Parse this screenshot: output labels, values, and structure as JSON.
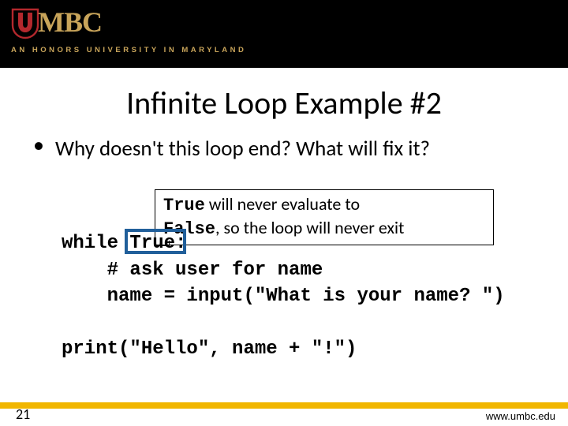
{
  "header": {
    "logo_text": "MBC",
    "honors_line": "AN HONORS UNIVERSITY IN MARYLAND"
  },
  "title": "Infinite Loop Example #2",
  "bullet": "Why doesn't this loop end?  What will fix it?",
  "callout": {
    "pre1": "True",
    "post1": "  will never evaluate to ",
    "pre2": "False",
    "post2": ", so the loop will never exit"
  },
  "code": {
    "block1": "while True:\n    # ask user for name\n    name = input(\"What is your name? \")",
    "block2": "print(\"Hello\", name + \"!\")",
    "highlight_word": "True"
  },
  "footer": {
    "page": "21",
    "url": "www.umbc.edu"
  },
  "colors": {
    "gold": "#C8A45A",
    "accentBlue": "#215F9A",
    "barGold": "#F1B600"
  }
}
